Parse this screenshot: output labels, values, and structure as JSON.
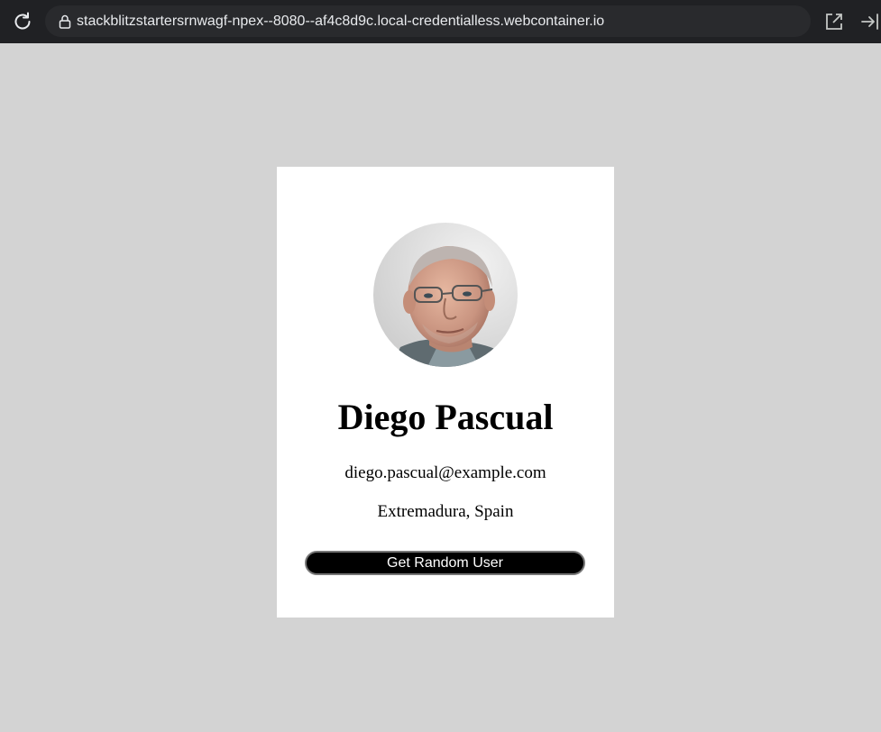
{
  "browser": {
    "url": "stackblitzstartersrnwagf-npex--8080--af4c8d9c.local-credentialless.webcontainer.io",
    "icons": [
      "reload-icon",
      "lock-icon",
      "open-external-icon",
      "dock-right-icon"
    ]
  },
  "user": {
    "name": "Diego Pascual",
    "email": "diego.pascual@example.com",
    "location": "Extremadura, Spain",
    "avatar_icon": "user-portrait-photo"
  },
  "actions": {
    "random_button_label": "Get Random User"
  },
  "colors": {
    "page_background": "#d3d3d3",
    "card_background": "#ffffff",
    "button_background": "#000000",
    "button_text": "#ffffff",
    "browser_bar": "#202124"
  }
}
